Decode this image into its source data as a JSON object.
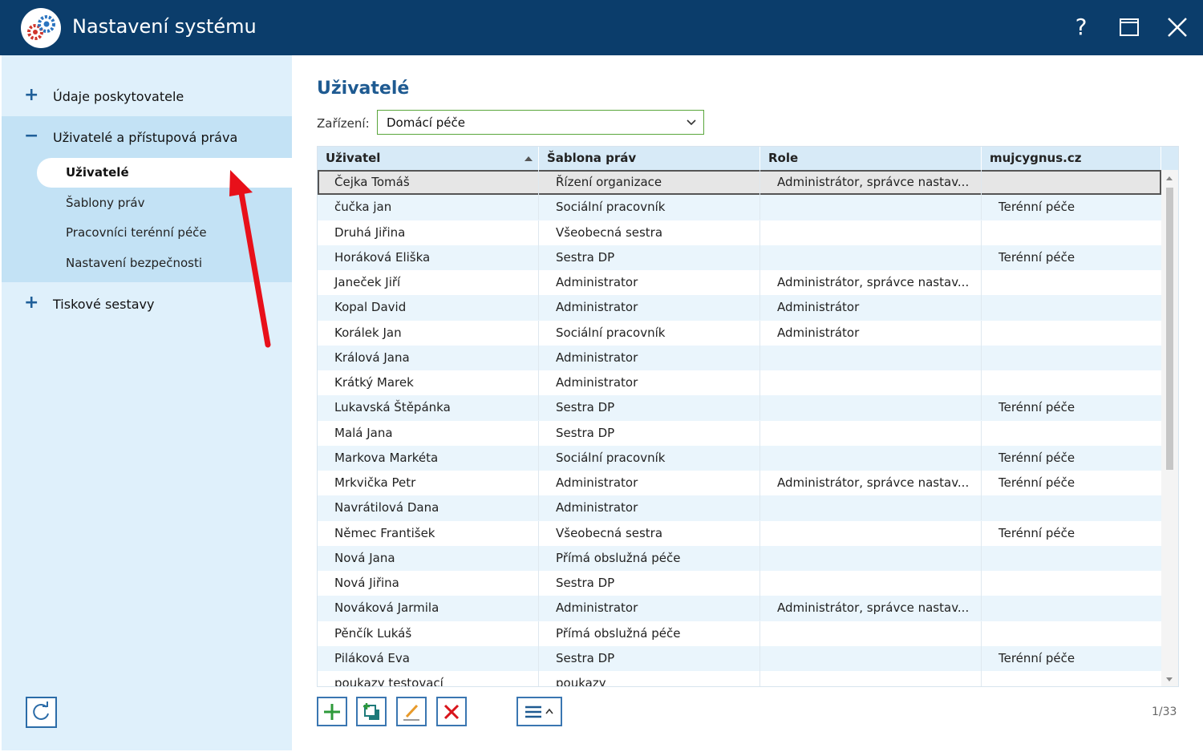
{
  "window": {
    "title": "Nastavení systému",
    "help": "?"
  },
  "sidebar": {
    "items": [
      {
        "icon": "plus-icon",
        "symbol": "+",
        "label": "Údaje poskytovatele"
      },
      {
        "icon": "minus-icon",
        "symbol": "−",
        "label": "Uživatelé a přístupová práva"
      },
      {
        "icon": "plus-icon",
        "symbol": "+",
        "label": "Tiskové sestavy"
      }
    ],
    "subitems": [
      {
        "label": "Uživatelé",
        "active": true
      },
      {
        "label": "Šablony práv",
        "active": false
      },
      {
        "label": "Pracovníci terénní péče",
        "active": false
      },
      {
        "label": "Nastavení bezpečnosti",
        "active": false
      }
    ],
    "refresh_icon": "refresh-icon"
  },
  "main": {
    "title": "Uživatelé",
    "facility_label": "Zařízení:",
    "facility_value": "Domácí péče",
    "columns": [
      "Uživatel",
      "Šablona práv",
      "Role",
      "mujcygnus.cz"
    ],
    "sort": {
      "column": "Uživatel",
      "direction": "ascending"
    },
    "rows": [
      [
        "Čejka Tomáš",
        "Řízení organizace",
        "Administrátor, správce nastav...",
        ""
      ],
      [
        "čučka jan",
        "Sociální pracovník",
        "",
        "Terénní péče"
      ],
      [
        "Druhá Jiřina",
        "Všeobecná sestra",
        "",
        ""
      ],
      [
        "Horáková Eliška",
        "Sestra DP",
        "",
        "Terénní péče"
      ],
      [
        "Janeček Jiří",
        "Administrator",
        "Administrátor, správce nastav...",
        ""
      ],
      [
        "Kopal David",
        "Administrator",
        "Administrátor",
        ""
      ],
      [
        "Korálek Jan",
        "Sociální pracovník",
        "Administrátor",
        ""
      ],
      [
        "Králová Jana",
        "Administrator",
        "",
        ""
      ],
      [
        "Krátký Marek",
        "Administrator",
        "",
        ""
      ],
      [
        "Lukavská Štěpánka",
        "Sestra DP",
        "",
        "Terénní péče"
      ],
      [
        "Malá Jana",
        "Sestra DP",
        "",
        ""
      ],
      [
        "Markova Markéta",
        "Sociální pracovník",
        "",
        "Terénní péče"
      ],
      [
        "Mrkvička Petr",
        "Administrator",
        "Administrátor, správce nastav...",
        "Terénní péče"
      ],
      [
        "Navrátilová Dana",
        "Administrator",
        "",
        ""
      ],
      [
        "Němec František",
        "Všeobecná sestra",
        "",
        "Terénní péče"
      ],
      [
        "Nová Jana",
        "Přímá obslužná péče",
        "",
        ""
      ],
      [
        "Nová Jiřina",
        "Sestra DP",
        "",
        ""
      ],
      [
        "Nováková Jarmila",
        "Administrator",
        "Administrátor, správce nastav...",
        ""
      ],
      [
        "Pěnčík Lukáš",
        "Přímá obslužná péče",
        "",
        ""
      ],
      [
        "Piláková Eva",
        "Sestra DP",
        "",
        "Terénní péče"
      ],
      [
        "poukazy testovací",
        "poukazy",
        "",
        ""
      ]
    ],
    "selected_row": 0,
    "counter": "1/33"
  },
  "toolbar": {
    "buttons": [
      "add-icon",
      "copy-add-icon",
      "edit-icon",
      "delete-icon",
      "menu-icon"
    ]
  },
  "colors": {
    "titlebar": "#0b3d6b",
    "sidebar": "#dff0fb",
    "sidebar_expanded": "#c3e2f5",
    "accent": "#1e5a91",
    "select_border": "#5aa63c",
    "delete": "#d9141b",
    "add": "#2e9a3a",
    "annotation_arrow": "#e8101a"
  }
}
